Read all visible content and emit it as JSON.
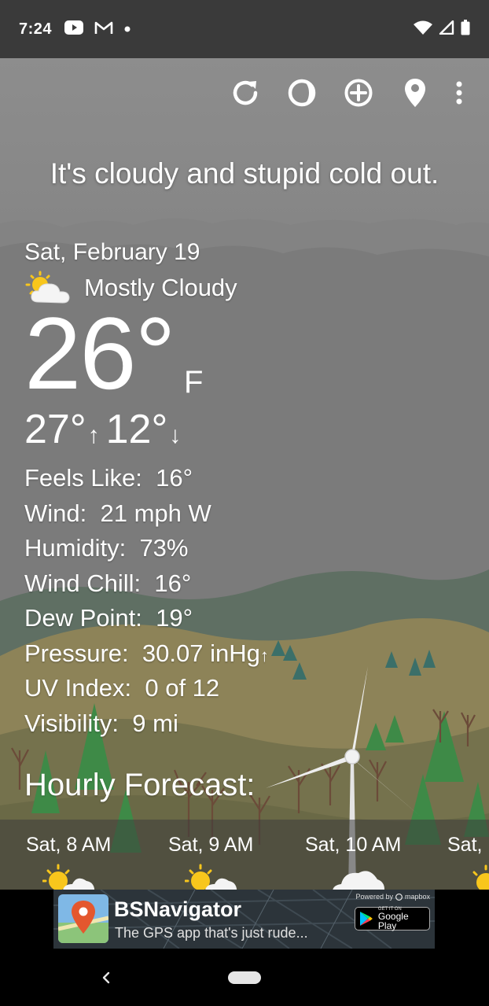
{
  "status_bar": {
    "time": "7:24"
  },
  "headline": "It's cloudy and stupid cold out.",
  "current": {
    "date": "Sat, February 19",
    "condition": "Mostly Cloudy",
    "temperature": "26°",
    "unit": "F",
    "high": "27°",
    "low": "12°"
  },
  "details": [
    {
      "label": "Feels Like:",
      "value": "16°"
    },
    {
      "label": "Wind:",
      "value": "21 mph W"
    },
    {
      "label": "Humidity:",
      "value": "73%"
    },
    {
      "label": "Wind Chill:",
      "value": "16°"
    },
    {
      "label": "Dew Point:",
      "value": "19°"
    },
    {
      "label": "Pressure:",
      "value": "30.07 inHg"
    },
    {
      "label": "UV Index:",
      "value": "0 of 12"
    },
    {
      "label": "Visibility:",
      "value": "9 mi"
    }
  ],
  "hourly": {
    "title": "Hourly Forecast:",
    "hours": [
      {
        "time": "Sat, 8 AM",
        "icon": "partly-sunny-icon"
      },
      {
        "time": "Sat, 9 AM",
        "icon": "partly-sunny-icon"
      },
      {
        "time": "Sat, 10 AM",
        "icon": "cloud-icon"
      },
      {
        "time": "Sat,",
        "icon": "sun-icon"
      }
    ]
  },
  "ad": {
    "title": "BSNavigator",
    "subtitle": "The GPS app that's just rude...",
    "powered_by": "Powered by",
    "provider": "mapbox",
    "store_small": "GET IT ON",
    "store_big": "Google Play"
  },
  "colors": {
    "sky": "#8d8d8d",
    "hills": "#77775f",
    "trees": "#3f8f4a"
  }
}
